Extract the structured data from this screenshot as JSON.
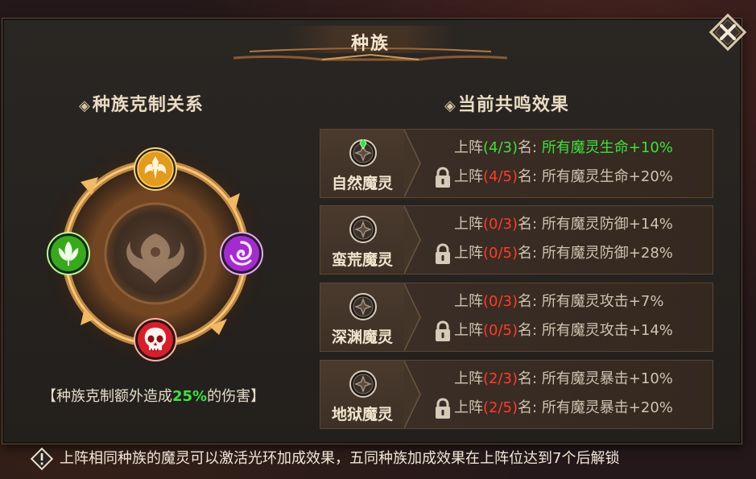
{
  "title": "种族",
  "left_section": {
    "heading": "种族克制关系",
    "note_prefix": "【种族克制额外造成",
    "note_highlight": "25%",
    "note_suffix": "的伤害】",
    "races": [
      {
        "name": "光明",
        "icon": "holy-wings-icon",
        "color": "#e29b1e"
      },
      {
        "name": "虚空",
        "icon": "swirl-icon",
        "color": "#a32ccf"
      },
      {
        "name": "深渊",
        "icon": "skull-icon",
        "color": "#d5202c"
      },
      {
        "name": "自然",
        "icon": "leaf-icon",
        "color": "#3aa81e"
      }
    ]
  },
  "right_section": {
    "heading": "当前共鸣效果",
    "effects": [
      {
        "name": "自然魔灵",
        "icon": "nature-emblem-icon",
        "active_gem": true,
        "line1": {
          "prefix": "上阵",
          "count": "(4/3)",
          "count_color": "green",
          "suffix": "名: ",
          "effect": "所有魔灵生命+10%",
          "active": true
        },
        "line2": {
          "prefix": "上阵",
          "count": "(4/5)",
          "count_color": "red",
          "suffix": "名: ",
          "effect": "所有魔灵生命+20%",
          "locked": true
        }
      },
      {
        "name": "蛮荒魔灵",
        "icon": "wild-emblem-icon",
        "active_gem": false,
        "line1": {
          "prefix": "上阵",
          "count": "(0/3)",
          "count_color": "red",
          "suffix": "名: ",
          "effect": "所有魔灵防御+14%",
          "active": false
        },
        "line2": {
          "prefix": "上阵",
          "count": "(0/5)",
          "count_color": "red",
          "suffix": "名: ",
          "effect": "所有魔灵防御+28%",
          "locked": true
        }
      },
      {
        "name": "深渊魔灵",
        "icon": "abyss-emblem-icon",
        "active_gem": false,
        "line1": {
          "prefix": "上阵",
          "count": "(0/3)",
          "count_color": "red",
          "suffix": "名: ",
          "effect": "所有魔灵攻击+7%",
          "active": false
        },
        "line2": {
          "prefix": "上阵",
          "count": "(0/5)",
          "count_color": "red",
          "suffix": "名: ",
          "effect": "所有魔灵攻击+14%",
          "locked": true
        }
      },
      {
        "name": "地狱魔灵",
        "icon": "hell-emblem-icon",
        "active_gem": false,
        "line1": {
          "prefix": "上阵",
          "count": "(2/3)",
          "count_color": "red",
          "suffix": "名: ",
          "effect": "所有魔灵暴击+10%",
          "active": false
        },
        "line2": {
          "prefix": "上阵",
          "count": "(2/5)",
          "count_color": "red",
          "suffix": "名: ",
          "effect": "所有魔灵暴击+20%",
          "locked": true
        }
      }
    ]
  },
  "footer_tip": "上阵相同种族的魔灵可以激活光环加成效果，五同种族加成效果在上阵位达到7个后解锁",
  "colors": {
    "active_green": "#3fe03f",
    "count_red": "#ff3b2a",
    "panel_bg": "#262220",
    "title_text": "#f3e6cf"
  }
}
